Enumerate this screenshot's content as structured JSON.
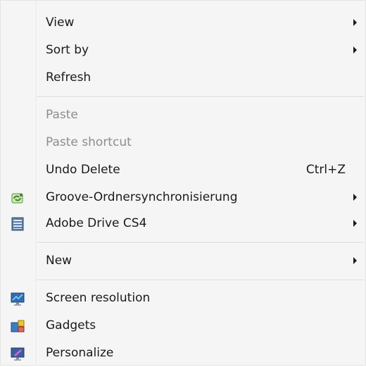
{
  "menu": {
    "view": {
      "label": "View"
    },
    "sort_by": {
      "label": "Sort by"
    },
    "refresh": {
      "label": "Refresh"
    },
    "paste": {
      "label": "Paste"
    },
    "paste_shortcut": {
      "label": "Paste shortcut"
    },
    "undo_delete": {
      "label": "Undo Delete",
      "shortcut": "Ctrl+Z"
    },
    "groove": {
      "label": "Groove-Ordnersynchronisierung",
      "icon": "groove-sync-icon"
    },
    "adobe_drive": {
      "label": "Adobe Drive CS4",
      "icon": "adobe-drive-icon"
    },
    "new": {
      "label": "New"
    },
    "screen_resolution": {
      "label": "Screen resolution",
      "icon": "monitor-icon"
    },
    "gadgets": {
      "label": "Gadgets",
      "icon": "gadgets-icon"
    },
    "personalize": {
      "label": "Personalize",
      "icon": "personalize-icon"
    }
  }
}
